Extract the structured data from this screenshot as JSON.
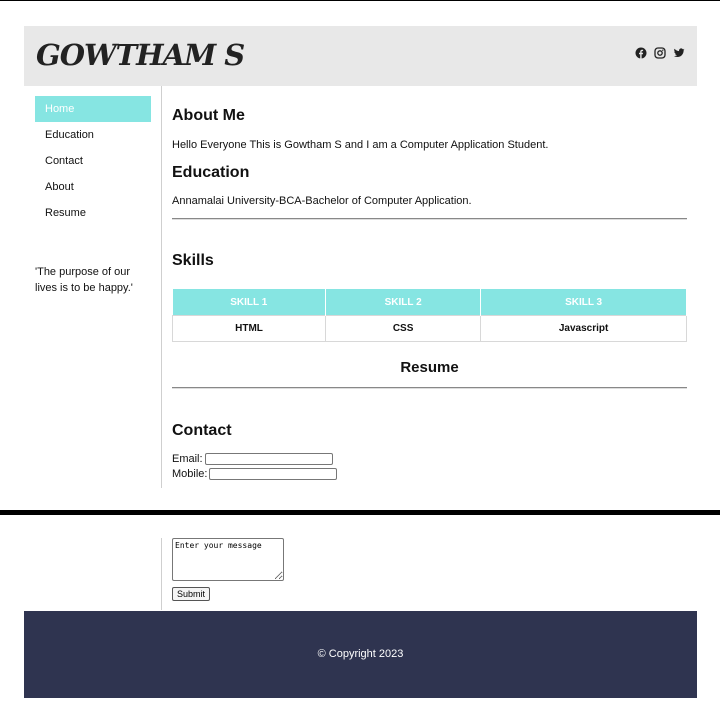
{
  "header": {
    "logo": "GOWTHAM S",
    "social": [
      "facebook-icon",
      "instagram-icon",
      "twitter-icon"
    ]
  },
  "sidebar": {
    "items": [
      {
        "label": "Home"
      },
      {
        "label": "Education"
      },
      {
        "label": "Contact"
      },
      {
        "label": "About"
      },
      {
        "label": "Resume"
      }
    ],
    "quote": "'The purpose of our lives is to be happy.'"
  },
  "about": {
    "title": "About Me",
    "text": "Hello Everyone This is Gowtham S and I am a Computer Application Student."
  },
  "education": {
    "title": "Education",
    "text": "Annamalai University-BCA-Bachelor of Computer Application."
  },
  "skills": {
    "title": "Skills",
    "headers": [
      "SKILL 1",
      "SKILL 2",
      "SKILL 3"
    ],
    "values": [
      "HTML",
      "CSS",
      "Javascript"
    ]
  },
  "resume": {
    "title": "Resume"
  },
  "contact": {
    "title": "Contact",
    "email_label": "Email:",
    "mobile_label": "Mobile:",
    "message_placeholder": "Enter your message",
    "submit_label": "Submit"
  },
  "footer": {
    "copyright": "© Copyright 2023"
  },
  "colors": {
    "accent": "#86e5e2",
    "footer_bg": "#2f3450",
    "header_bg": "#e8e8e8"
  }
}
